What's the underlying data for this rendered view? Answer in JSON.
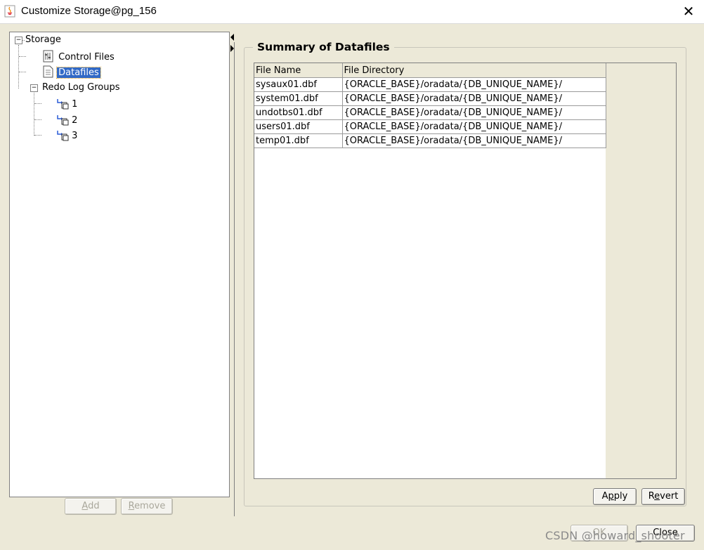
{
  "window": {
    "title": "Customize Storage@pg_156",
    "close_glyph": "✕"
  },
  "tree": {
    "root": {
      "label": "Storage",
      "icon": "minus-box-icon"
    },
    "items": [
      {
        "label": "Control Files",
        "icon": "control-files-icon"
      },
      {
        "label": "Datafiles",
        "icon": "datafile-icon",
        "selected": true
      },
      {
        "label": "Redo Log Groups",
        "icon": "minus-box-icon"
      }
    ],
    "redo_groups": [
      "1",
      "2",
      "3"
    ]
  },
  "tree_buttons": {
    "add": {
      "mnemonic": "A",
      "rest": "dd"
    },
    "remove": {
      "mnemonic": "R",
      "rest": "emove"
    }
  },
  "panel": {
    "title": "Summary of Datafiles",
    "columns": [
      "File Name",
      "File Directory"
    ],
    "rows": [
      [
        "sysaux01.dbf",
        "{ORACLE_BASE}/oradata/{DB_UNIQUE_NAME}/"
      ],
      [
        "system01.dbf",
        "{ORACLE_BASE}/oradata/{DB_UNIQUE_NAME}/"
      ],
      [
        "undotbs01.dbf",
        "{ORACLE_BASE}/oradata/{DB_UNIQUE_NAME}/"
      ],
      [
        "users01.dbf",
        "{ORACLE_BASE}/oradata/{DB_UNIQUE_NAME}/"
      ],
      [
        "temp01.dbf",
        "{ORACLE_BASE}/oradata/{DB_UNIQUE_NAME}/"
      ]
    ]
  },
  "actions": {
    "apply": {
      "pre": "A",
      "mnemonic": "p",
      "rest": "ply"
    },
    "revert": {
      "pre": "R",
      "mnemonic": "e",
      "rest": "vert"
    },
    "ok": "OK",
    "close": "Close"
  },
  "watermark": "CSDN @howard_shooter",
  "colors": {
    "selection": "#3169c6",
    "window_bg": "#ece9d8",
    "selection_outline": "#e0a020"
  }
}
